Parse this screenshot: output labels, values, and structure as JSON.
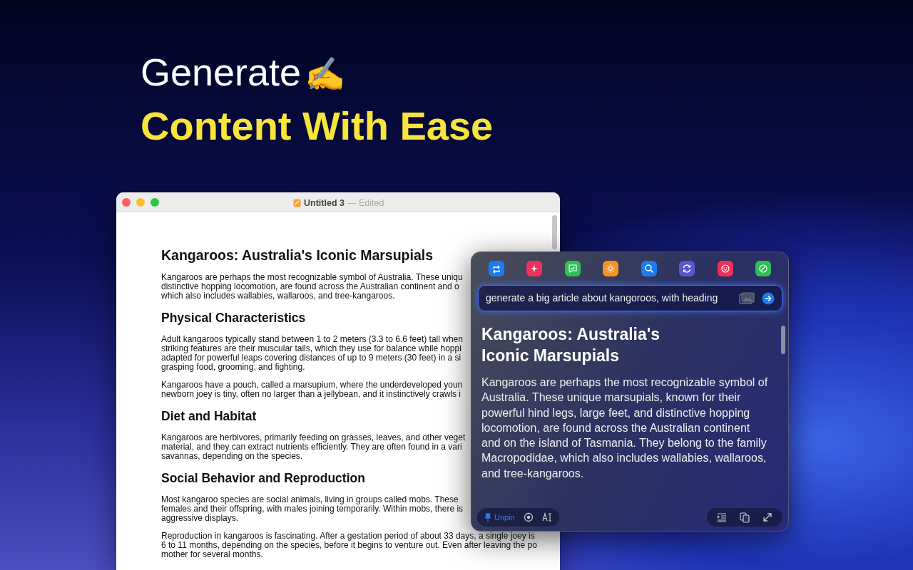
{
  "headline": {
    "line_1": "Generate",
    "emoji": "✍️",
    "line_2": "Content With Ease"
  },
  "document_window": {
    "title": "Untitled 3",
    "status": "— Edited",
    "blocks": [
      {
        "kind": "heading",
        "lines": [
          "Kangaroos: Australia's Iconic Marsupials"
        ]
      },
      {
        "kind": "paragraph",
        "lines": [
          "Kangaroos are perhaps the most recognizable symbol of Australia. These uniqu",
          "distinctive hopping locomotion, are found across the Australian continent and o",
          "which also includes wallabies, wallaroos, and tree-kangaroos."
        ]
      },
      {
        "kind": "subheading",
        "lines": [
          "Physical Characteristics"
        ]
      },
      {
        "kind": "paragraph",
        "lines": [
          "Adult kangaroos typically stand between 1 to 2 meters (3.3 to 6.6 feet) tall when",
          "striking features are their muscular tails, which they use for balance while hoppi",
          "adapted for powerful leaps covering distances of up to 9 meters (30 feet) in a si",
          "grasping food, grooming, and fighting."
        ]
      },
      {
        "kind": "paragraph",
        "lines": [
          "Kangaroos have a pouch, called a marsupium, where the underdeveloped youn",
          "newborn joey is tiny, often no larger than a jellybean, and it instinctively crawls i"
        ]
      },
      {
        "kind": "subheading",
        "lines": [
          "Diet and Habitat"
        ]
      },
      {
        "kind": "paragraph",
        "lines": [
          "Kangaroos are herbivores, primarily feeding on grasses, leaves, and other veget",
          "material, and they can extract nutrients efficiently. They are often found in a vari",
          "savannas, depending on the species."
        ]
      },
      {
        "kind": "subheading",
        "lines": [
          "Social Behavior and Reproduction"
        ]
      },
      {
        "kind": "paragraph",
        "lines": [
          "Most kangaroo species are social animals, living in groups called mobs. These",
          "females and their offspring, with males joining temporarily. Within mobs, there is",
          "aggressive displays."
        ]
      },
      {
        "kind": "paragraph",
        "lines": [
          "Reproduction in kangaroos is fascinating. After a gestation period of about 33 days, a single joey is",
          "6 to 11 months, depending on the species, before it begins to venture out. Even after leaving the po",
          "mother for several months."
        ]
      }
    ]
  },
  "assistant_panel": {
    "tools": [
      {
        "color": "#1a7cf0"
      },
      {
        "color": "#f0305a"
      },
      {
        "color": "#2fbf55"
      },
      {
        "color": "#f7921e"
      },
      {
        "color": "#1a7cf0"
      },
      {
        "color": "#5a56d6"
      },
      {
        "color": "#f0305a"
      },
      {
        "color": "#2fbf55"
      }
    ],
    "prompt": {
      "value": "generate a big article about kangoroos, with heading"
    },
    "response": {
      "heading": "Kangaroos: Australia's Iconic Marsupials",
      "paragraph": "Kangaroos are perhaps the most recognizable symbol of Australia. These unique marsupials, known for their powerful hind legs, large feet, and distinctive hopping locomotion, are found across the Australian continent and on the island of Tasmania. They belong to the family Macropodidae, which also includes wallabies, wallaroos, and tree-kangaroos."
    },
    "pin": {
      "label": "Unpin",
      "pinned": true
    }
  }
}
